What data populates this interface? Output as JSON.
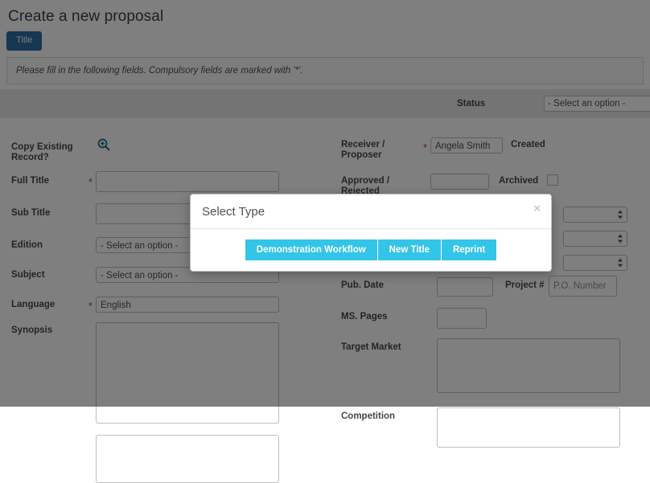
{
  "page": {
    "title": "Create a new proposal",
    "tab_label": "Title",
    "info_text": "Please fill in the following fields. Compulsory fields are marked with '*'.",
    "status_label": "Status",
    "status_value": "- Select an option -"
  },
  "left_fields": [
    {
      "label": "Copy Existing Record?",
      "type": "icon",
      "icon": "zoom-in-icon",
      "required": false,
      "value": ""
    },
    {
      "label": "Full Title",
      "type": "text",
      "required": true,
      "value": ""
    },
    {
      "label": "Sub Title",
      "type": "text",
      "required": false,
      "value": ""
    },
    {
      "label": "Edition",
      "type": "select",
      "required": false,
      "value": "- Select an option -"
    },
    {
      "label": "Subject",
      "type": "select",
      "required": false,
      "value": "- Select an option -"
    },
    {
      "label": "Language",
      "type": "select",
      "required": true,
      "value": "English"
    },
    {
      "label": "Synopsis",
      "type": "textarea",
      "required": false,
      "value": ""
    },
    {
      "label": "",
      "type": "textarea2",
      "required": false,
      "value": ""
    }
  ],
  "right_fields": [
    {
      "label": "Receiver / Proposer",
      "type": "select",
      "required": true,
      "value": "Angela Smith",
      "aux_label": "Created"
    },
    {
      "label": "Approved / Rejected",
      "type": "select",
      "required": false,
      "value": "",
      "aux_label": "Archived",
      "aux_type": "checkbox"
    },
    {
      "label": "Pub. Date",
      "type": "text",
      "required": false,
      "value": "",
      "aux_label": "Project #",
      "aux_value": "P.O. Number"
    },
    {
      "label": "MS. Pages",
      "type": "text",
      "required": false,
      "value": ""
    },
    {
      "label": "Target Market",
      "type": "textarea",
      "required": false,
      "value": ""
    },
    {
      "label": "Competition",
      "type": "textarea",
      "required": false,
      "value": ""
    }
  ],
  "right_extra_selects": 3,
  "modal": {
    "title": "Select Type",
    "close_label": "×",
    "buttons": [
      {
        "label": "Demonstration Workflow"
      },
      {
        "label": "New Title"
      },
      {
        "label": "Reprint"
      }
    ]
  },
  "colors": {
    "accent_cyan": "#33c5e8",
    "tab_blue": "#2e6da4",
    "required_red": "#c0392b",
    "icon_blue": "#16658f"
  }
}
